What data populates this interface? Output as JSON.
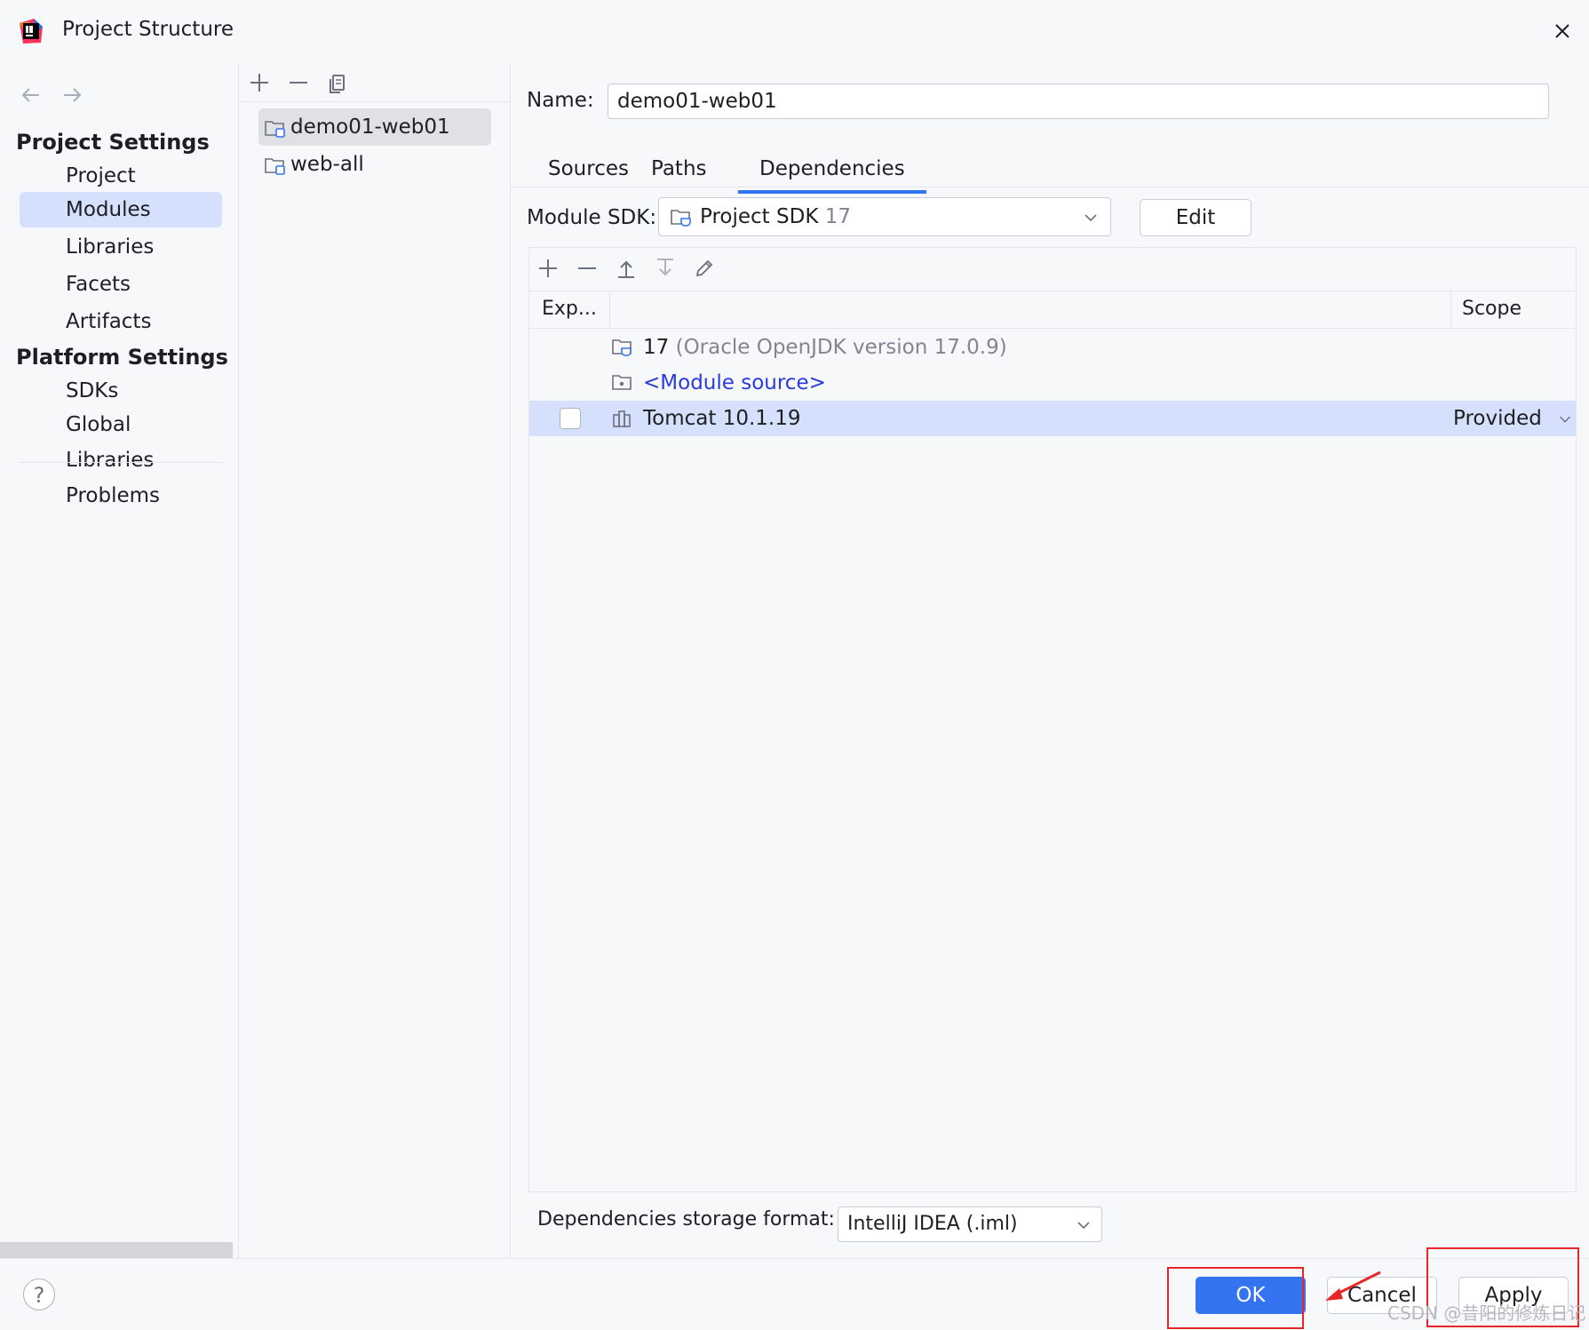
{
  "window": {
    "title": "Project Structure"
  },
  "nav": {
    "project_settings_header": "Project Settings",
    "project_items": [
      {
        "label": "Project"
      },
      {
        "label": "Modules",
        "selected": true
      },
      {
        "label": "Libraries"
      },
      {
        "label": "Facets"
      },
      {
        "label": "Artifacts"
      }
    ],
    "platform_settings_header": "Platform Settings",
    "platform_items": [
      {
        "label": "SDKs"
      },
      {
        "label": "Global Libraries"
      }
    ],
    "problems": "Problems"
  },
  "modules": {
    "items": [
      {
        "label": "demo01-web01",
        "selected": true
      },
      {
        "label": "web-all"
      }
    ]
  },
  "details": {
    "name_label": "Name:",
    "name_value": "demo01-web01",
    "tabs": [
      {
        "label": "Sources"
      },
      {
        "label": "Paths"
      },
      {
        "label": "Dependencies",
        "active": true
      }
    ],
    "module_sdk_label": "Module SDK:",
    "module_sdk_value": "Project SDK",
    "module_sdk_version": "17",
    "edit_button": "Edit",
    "table": {
      "col_export": "Exp...",
      "col_scope": "Scope",
      "rows": [
        {
          "name": "17",
          "detail": "(Oracle OpenJDK version 17.0.9)",
          "icon": "jdk-folder-icon"
        },
        {
          "name": "<Module source>",
          "icon": "module-source-icon"
        },
        {
          "name": "Tomcat 10.1.19",
          "scope": "Provided",
          "exported": false,
          "selected": true,
          "icon": "library-icon"
        }
      ]
    },
    "storage_format_label": "Dependencies storage format:",
    "storage_format_value": "IntelliJ IDEA (.iml)"
  },
  "buttons": {
    "help": "?",
    "ok": "OK",
    "cancel": "Cancel",
    "apply": "Apply"
  },
  "watermark": "CSDN @昔阳的修炼日记",
  "colors": {
    "accent": "#3574f0",
    "selection": "#d5e1fc",
    "link_blue": "#2a3bdb",
    "annotation_red": "#e8262a"
  }
}
